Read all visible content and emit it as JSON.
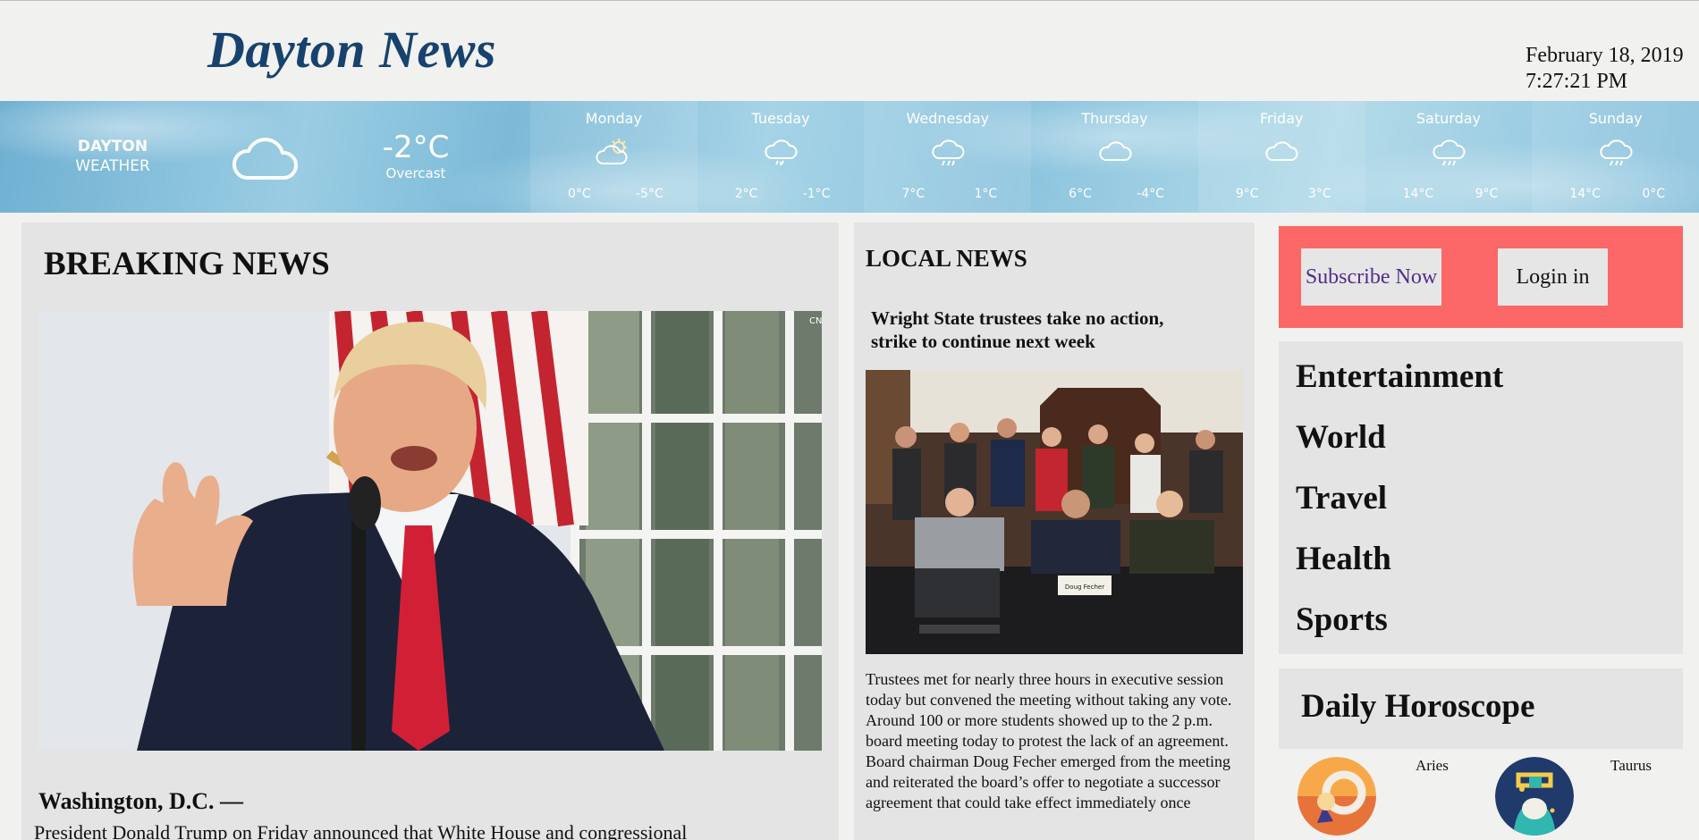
{
  "masthead": {
    "title": "Dayton News",
    "date": "February 18, 2019",
    "time": "7:27:21 PM"
  },
  "weather": {
    "city_line1": "DAYTON",
    "city_line2": "WEATHER",
    "current_icon": "cloud-icon",
    "current_temp": "-2°C",
    "current_desc": "Overcast",
    "days": [
      {
        "name": "Monday",
        "icon": "partly-sunny-icon",
        "hi": "0°C",
        "lo": "-5°C"
      },
      {
        "name": "Tuesday",
        "icon": "snow-cloud-icon",
        "hi": "2°C",
        "lo": "-1°C"
      },
      {
        "name": "Wednesday",
        "icon": "rain-cloud-icon",
        "hi": "7°C",
        "lo": "1°C"
      },
      {
        "name": "Thursday",
        "icon": "cloud-icon",
        "hi": "6°C",
        "lo": "-4°C"
      },
      {
        "name": "Friday",
        "icon": "cloud-icon",
        "hi": "9°C",
        "lo": "3°C"
      },
      {
        "name": "Saturday",
        "icon": "rain-cloud-icon",
        "hi": "14°C",
        "lo": "9°C"
      },
      {
        "name": "Sunday",
        "icon": "rain-cloud-icon",
        "hi": "14°C",
        "lo": "0°C"
      }
    ]
  },
  "breaking": {
    "heading": "BREAKING NEWS",
    "dateline": "Washington, D.C. —",
    "lead": "President Donald Trump on Friday announced that White House and congressional"
  },
  "local": {
    "heading": "LOCAL NEWS",
    "headline": "Wright State trustees take no action, strike to continue next week",
    "body": "Trustees met for nearly three hours in executive session today but convened the meeting without taking any vote. Around 100 or more students showed up to the 2 p.m. board meeting today to protest the lack of an agreement. Board chairman Doug Fecher emerged from the meeting and reiterated the board’s offer to negotiate a successor agreement that could take effect immediately once",
    "nameplate": "Doug Fecher"
  },
  "auth": {
    "subscribe": "Subscribe Now",
    "login": "Login in",
    "subscribe_color": "#4f2e8a",
    "box_color": "#fc6767"
  },
  "categories": [
    "Entertainment",
    "World",
    "Travel",
    "Health",
    "Sports"
  ],
  "horoscope": {
    "heading": "Daily Horoscope",
    "signs": [
      {
        "name": "Aries",
        "icon": "ram-icon"
      },
      {
        "name": "Taurus",
        "icon": "bull-icon"
      }
    ]
  },
  "colors": {
    "masthead": "#17426e",
    "panel": "#e4e4e4",
    "background": "#f1f1ef"
  }
}
